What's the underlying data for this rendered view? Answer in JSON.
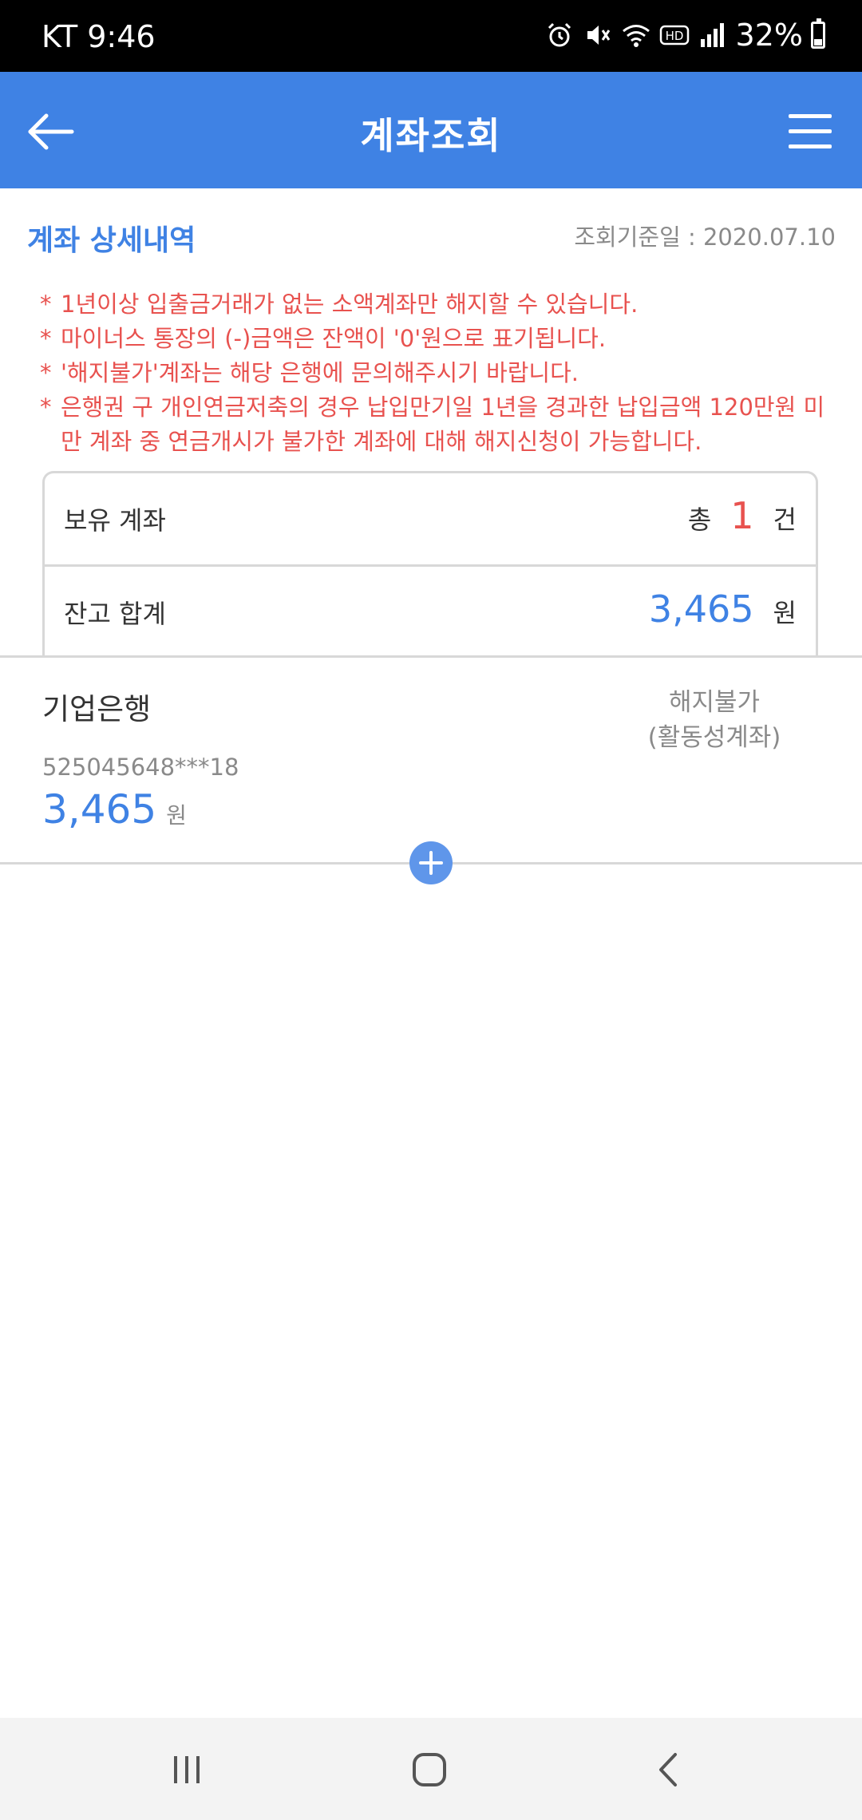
{
  "status_bar": {
    "carrier_time": "KT 9:46",
    "battery": "32%",
    "icons": [
      "alarm-icon",
      "mute-icon",
      "wifi-icon",
      "hd-icon",
      "signal-icon",
      "battery-icon"
    ]
  },
  "header": {
    "title": "계좌조회",
    "back_icon": "arrow-left-icon",
    "menu_icon": "hamburger-menu-icon",
    "background_color": "#3f82e4"
  },
  "section": {
    "title": "계좌 상세내역",
    "date_label": "조회기준일 : 2020.07.10"
  },
  "notices": [
    "1년이상 입출금거래가 없는 소액계좌만 해지할 수 있습니다.",
    "마이너스 통장의 (-)금액은 잔액이 '0'원으로 표기됩니다.",
    "'해지불가'계좌는 해당 은행에 문의해주시기 바랍니다.",
    "은행권 구 개인연금저축의 경우 납입만기일 1년을 경과한 납입금액 120만원 미만 계좌 중 연금개시가 불가한 계좌에 대해 해지신청이 가능합니다."
  ],
  "notice_bullet": "*",
  "summary": {
    "held_label": "보유 계좌",
    "count_prefix": "총",
    "count": "1",
    "count_unit": "건",
    "balance_label": "잔고 합계",
    "balance": "3,465",
    "balance_unit": "원"
  },
  "account": {
    "bank": "기업은행",
    "status_line1": "해지불가",
    "status_line2": "(활동성계좌)",
    "number": "525045648***18",
    "balance": "3,465",
    "unit": "원"
  },
  "expand_icon": "plus-circle-icon",
  "nav": {
    "recents_icon": "recents-icon",
    "home_icon": "home-icon",
    "back_icon": "nav-back-icon"
  },
  "colors": {
    "accent": "#3f82e4",
    "warning": "#e8524f",
    "muted": "#8a8a8a"
  }
}
